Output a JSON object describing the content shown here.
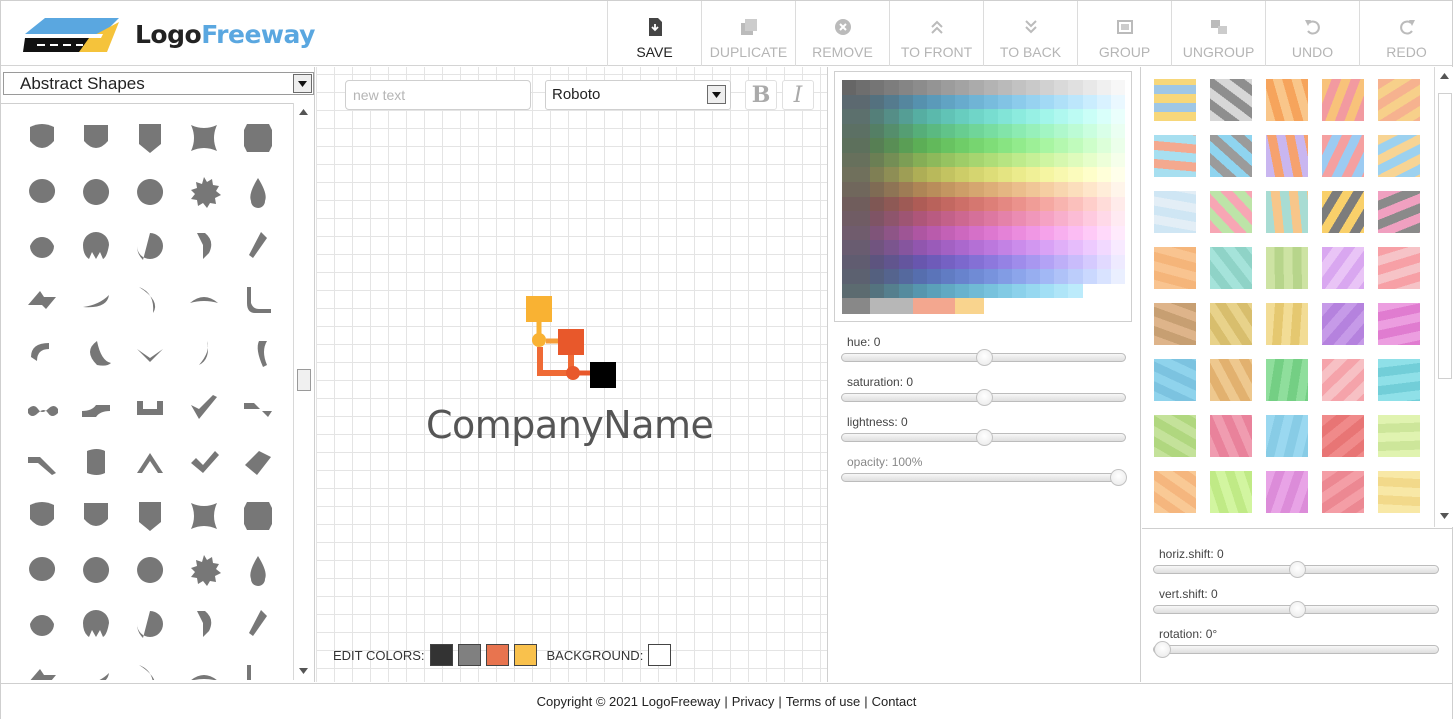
{
  "brand": {
    "part1": "Logo",
    "part2": "Freeway",
    "accent": "#5aa7e0"
  },
  "toolbar": [
    {
      "label": "SAVE",
      "icon": "save-icon",
      "enabled": true
    },
    {
      "label": "DUPLICATE",
      "icon": "duplicate-icon",
      "enabled": false
    },
    {
      "label": "REMOVE",
      "icon": "remove-icon",
      "enabled": false
    },
    {
      "label": "TO FRONT",
      "icon": "to-front-icon",
      "enabled": false
    },
    {
      "label": "TO BACK",
      "icon": "to-back-icon",
      "enabled": false
    },
    {
      "label": "GROUP",
      "icon": "group-icon",
      "enabled": false
    },
    {
      "label": "UNGROUP",
      "icon": "ungroup-icon",
      "enabled": false
    },
    {
      "label": "UNDO",
      "icon": "undo-icon",
      "enabled": false
    },
    {
      "label": "REDO",
      "icon": "redo-icon",
      "enabled": false
    }
  ],
  "shapes": {
    "category": "Abstract Shapes",
    "color": "#777777"
  },
  "editor": {
    "text_placeholder": "new text",
    "font": "Roboto",
    "bold_label": "B",
    "italic_label": "I",
    "company_text": "CompanyName",
    "edit_colors_label": "EDIT COLORS:",
    "colors": [
      "#333333",
      "#808080",
      "#e8744f",
      "#f9c14c"
    ],
    "background_label": "BACKGROUND:",
    "background": "#ffffff"
  },
  "sliders_color": [
    {
      "label": "hue: 0",
      "value": 0.5
    },
    {
      "label": "saturation: 0",
      "value": 0.5
    },
    {
      "label": "lightness: 0",
      "value": 0.5
    },
    {
      "label": "opacity: 100%",
      "value": 1.0
    }
  ],
  "sliders_pattern": [
    {
      "label": "horiz.shift: 0",
      "value": 0.5
    },
    {
      "label": "vert.shift: 0",
      "value": 0.5
    },
    {
      "label": "rotation: 0°",
      "value": 0.0
    }
  ],
  "footer": {
    "copyright": "Copyright © 2021 LogoFreeway",
    "privacy": "Privacy",
    "terms": "Terms of use",
    "contact": "Contact"
  }
}
